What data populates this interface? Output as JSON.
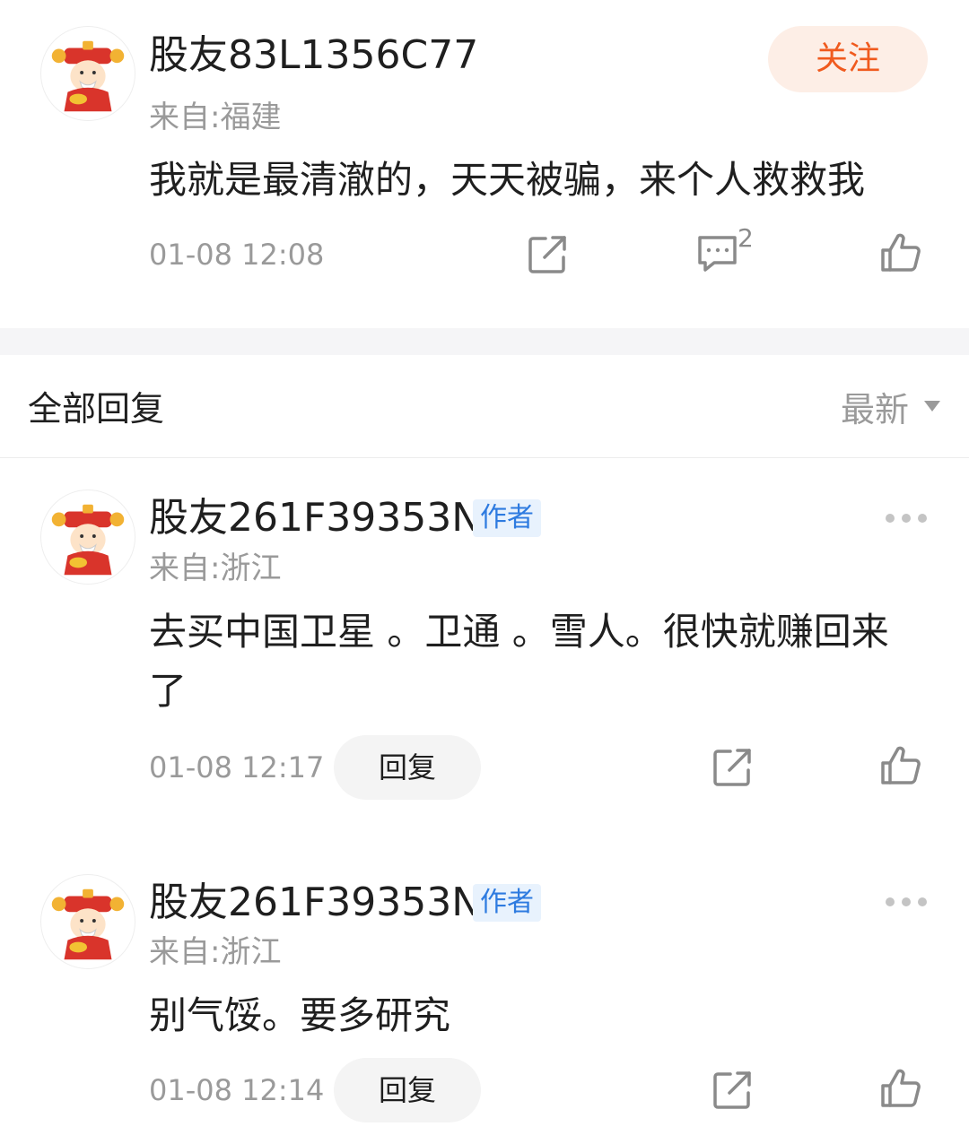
{
  "main_post": {
    "username": "股友83L1356C77",
    "location": "来自:福建",
    "content": "我就是最清澈的，天天被骗，来个人救救我",
    "time": "01-08 12:08",
    "follow_label": "关注",
    "comment_count": "2",
    "icons": [
      "share-icon",
      "comment-icon",
      "like-icon"
    ]
  },
  "replies_header": {
    "title": "全部回复",
    "sort_label": "最新"
  },
  "replies": [
    {
      "username": "股友261F39353N",
      "badge": "作者",
      "location": "来自:浙江",
      "content": "去买中国卫星 。卫通 。雪人。很快就赚回来了",
      "time": "01-08 12:17",
      "reply_label": "回复"
    },
    {
      "username": "股友261F39353N",
      "badge": "作者",
      "location": "来自:浙江",
      "content": "别气馁。要多研究",
      "time": "01-08 12:14",
      "reply_label": "回复"
    }
  ],
  "colors": {
    "accent_orange": "#f05a1e",
    "follow_bg": "#fdeee6",
    "author_badge_text": "#2e7be0",
    "author_badge_bg": "#e8f2fd",
    "muted_text": "#9a9a9a"
  }
}
